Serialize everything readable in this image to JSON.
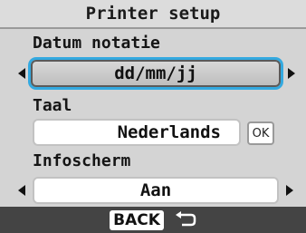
{
  "header": {
    "title": "Printer setup"
  },
  "settings": [
    {
      "label": "Datum notatie",
      "value": "dd/mm/jj"
    },
    {
      "label": "Taal",
      "value": "Nederlands",
      "confirm_label": "OK"
    },
    {
      "label": "Infoscherm",
      "value": "Aan"
    }
  ],
  "footer": {
    "back_label": "BACK",
    "back_icon": "return-arrow-icon"
  },
  "colors": {
    "highlight": "#33a9e0",
    "footer_bg": "#444444"
  }
}
